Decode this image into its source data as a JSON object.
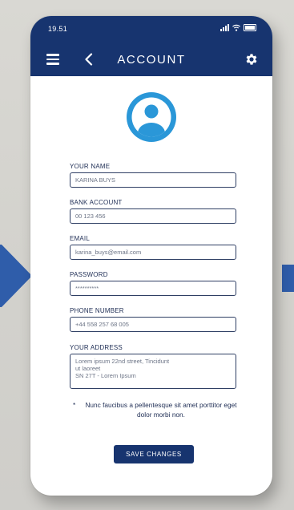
{
  "colors": {
    "header_bg": "#17346f",
    "accent_blue": "#2a97d8",
    "button_bg": "#17346f",
    "text_dark": "#1e2d54",
    "arrow_blue": "#2f5daa"
  },
  "status_bar": {
    "time": "19.51",
    "icons": [
      "signal-icon",
      "wifi-icon",
      "battery-icon"
    ]
  },
  "header": {
    "title": "ACCOUNT",
    "left_icons": [
      "menu-icon",
      "back-icon"
    ],
    "right_icon": "gear-icon"
  },
  "avatar": {
    "icon": "user-avatar-icon"
  },
  "form": {
    "name": {
      "label": "YOUR NAME",
      "value": "KARINA BUYS"
    },
    "bank": {
      "label": "BANK ACCOUNT",
      "value": "00 123 456"
    },
    "email": {
      "label": "EMAIL",
      "value": "karina_buys@email.com"
    },
    "password": {
      "label": "PASSWORD",
      "value": "**********"
    },
    "phone": {
      "label": "PHONE NUMBER",
      "value": "+44 558 257 68 005"
    },
    "address": {
      "label": "YOUR ADDRESS",
      "lines": [
        "Lorem ipsum 22nd street, Tincidunt",
        "ut laoreet",
        "SN 27T - Lorem Ipsum"
      ]
    }
  },
  "note": {
    "marker": "*",
    "text": "Nunc faucibus a pellentesque sit amet porttitor eget dolor morbi non."
  },
  "save_button": {
    "label": "SAVE CHANGES"
  }
}
